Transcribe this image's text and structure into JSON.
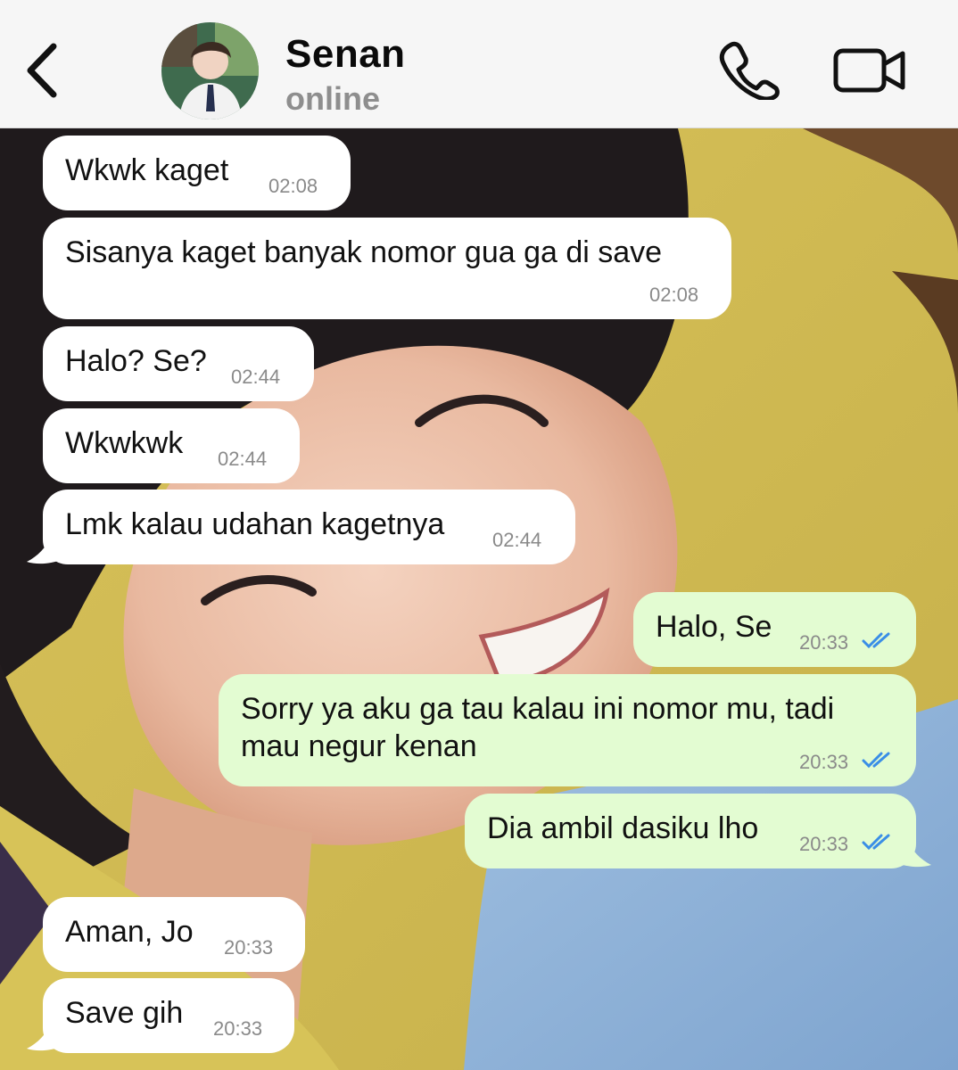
{
  "header": {
    "contact_name": "Senan",
    "status": "online"
  },
  "icons": {
    "back": "chevron-left-icon",
    "call": "phone-icon",
    "video": "video-camera-icon",
    "read_receipt": "double-check-icon"
  },
  "colors": {
    "header_bg": "#f6f6f6",
    "incoming_bubble": "#ffffff",
    "outgoing_bubble": "#e3fcd2",
    "read_tick": "#3a8ee6",
    "timestamp": "#8a8a8a"
  },
  "messages": [
    {
      "direction": "incoming",
      "text": "Wkwk kaget",
      "time": "02:08"
    },
    {
      "direction": "incoming",
      "text": "Sisanya kaget banyak nomor gua ga di save",
      "time": "02:08"
    },
    {
      "direction": "incoming",
      "text": "Halo? Se?",
      "time": "02:44"
    },
    {
      "direction": "incoming",
      "text": "Wkwkwk",
      "time": "02:44"
    },
    {
      "direction": "incoming",
      "text": "Lmk kalau udahan kagetnya",
      "time": "02:44"
    },
    {
      "direction": "outgoing",
      "text": "Halo, Se",
      "time": "20:33",
      "read": true
    },
    {
      "direction": "outgoing",
      "text_line1": "Sorry ya aku ga tau kalau ini nomor mu, tadi",
      "text_line2": "mau negur kenan",
      "time": "20:33",
      "read": true
    },
    {
      "direction": "outgoing",
      "text": "Dia ambil dasiku lho",
      "time": "20:33",
      "read": true
    },
    {
      "direction": "incoming",
      "text": "Aman, Jo",
      "time": "20:33"
    },
    {
      "direction": "incoming",
      "text": "Save gih",
      "time": "20:33"
    }
  ]
}
